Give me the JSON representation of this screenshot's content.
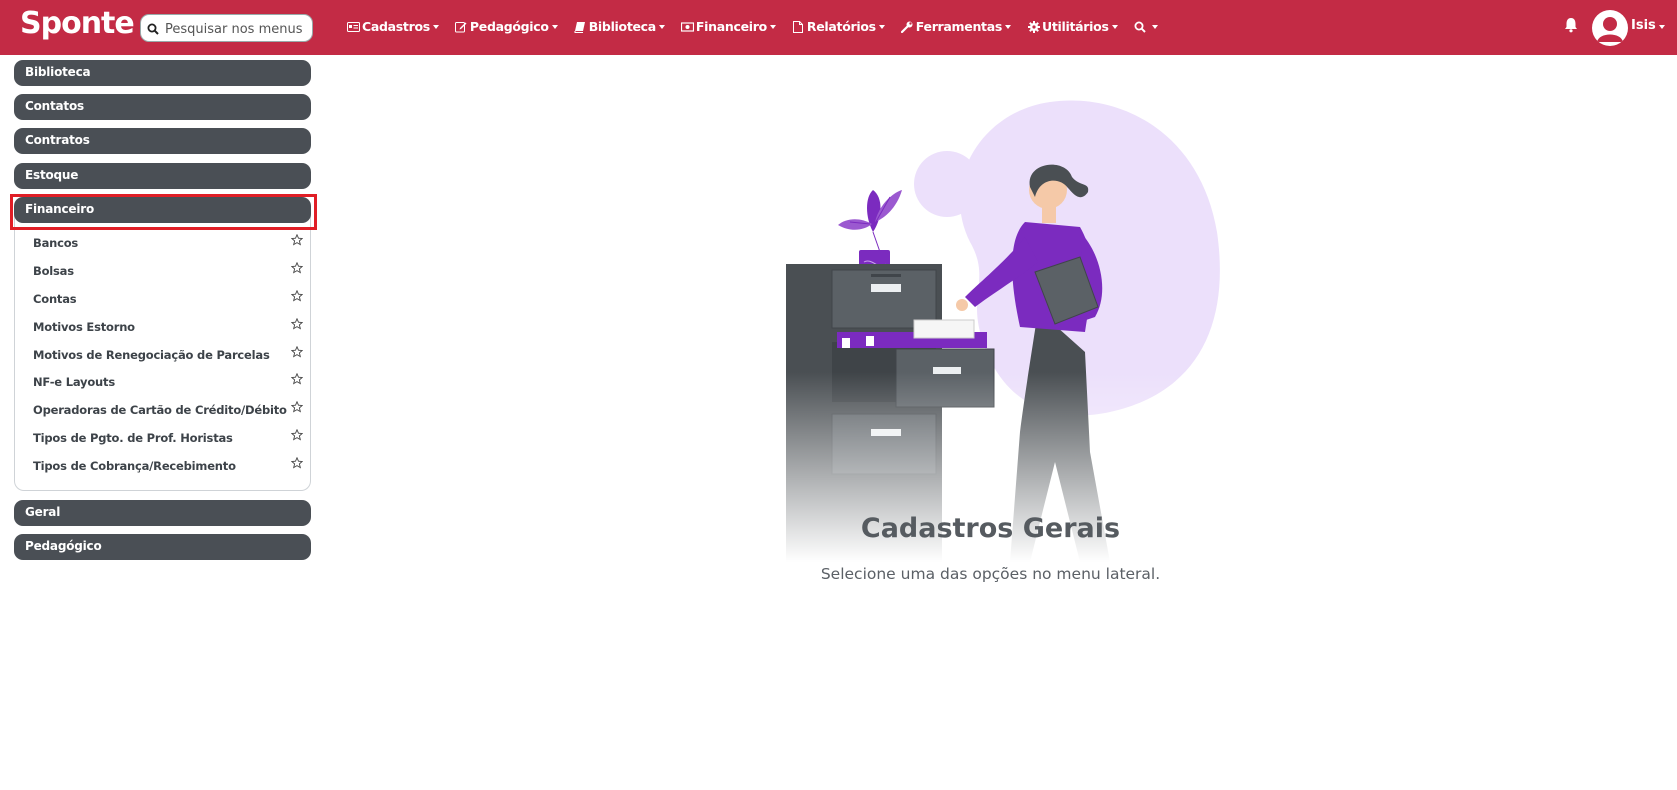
{
  "brand": "Sponte",
  "search": {
    "placeholder": "Pesquisar nos menus"
  },
  "nav": [
    {
      "label": "Cadastros",
      "icon": "id-card-icon"
    },
    {
      "label": "Pedagógico",
      "icon": "edit-icon"
    },
    {
      "label": "Biblioteca",
      "icon": "book-icon"
    },
    {
      "label": "Financeiro",
      "icon": "money-bill-icon"
    },
    {
      "label": "Relatórios",
      "icon": "file-icon"
    },
    {
      "label": "Ferramentas",
      "icon": "wrench-icon"
    },
    {
      "label": "Utilitários",
      "icon": "gear-icon"
    },
    {
      "label": "",
      "icon": "search-icon"
    }
  ],
  "user": {
    "name": "Isis"
  },
  "sidebar": {
    "groups_top": [
      "Biblioteca",
      "Contatos",
      "Contratos",
      "Estoque",
      "Financeiro"
    ],
    "financeiro_items": [
      "Bancos",
      "Bolsas",
      "Contas",
      "Motivos Estorno",
      "Motivos de Renegociação de Parcelas",
      "NF-e Layouts",
      "Operadoras de Cartão de Crédito/Débito",
      "Tipos de Pgto. de Prof. Horistas",
      "Tipos de Cobrança/Recebimento"
    ],
    "groups_bottom": [
      "Geral",
      "Pedagógico"
    ]
  },
  "main": {
    "title": "Cadastros Gerais",
    "subtitle": "Selecione uma das opções no menu lateral."
  },
  "colors": {
    "navbar": "#c32b45",
    "sidebar_group": "#4a4f55",
    "accent": "#7b2bbf",
    "highlight": "#e01e26"
  }
}
